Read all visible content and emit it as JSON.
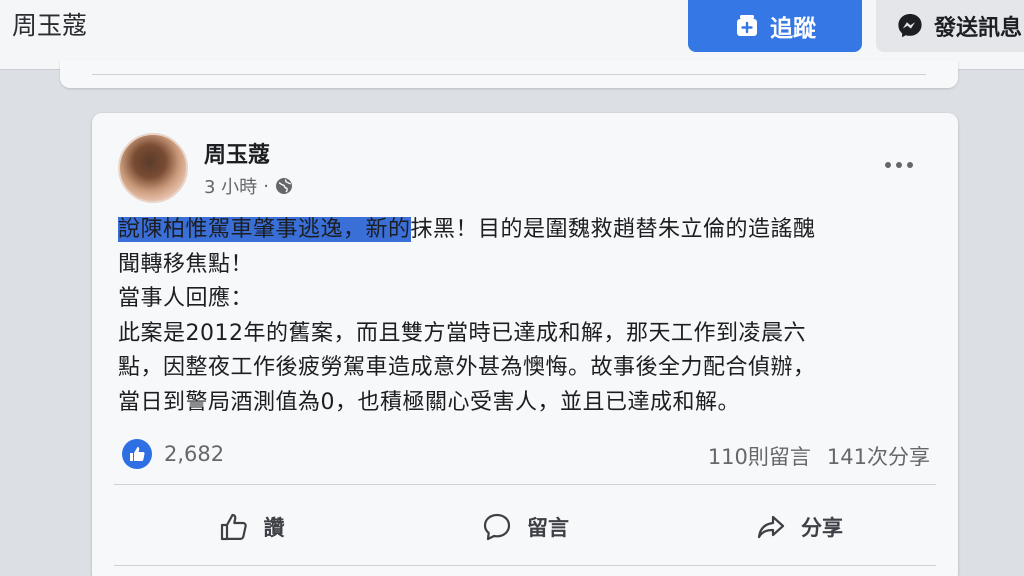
{
  "header": {
    "page_name": "周玉蔻",
    "follow_label": "追蹤",
    "message_label": "發送訊息"
  },
  "post": {
    "author": "周玉蔻",
    "time": "3 小時",
    "separator": "·",
    "highlighted_text": "說陳柏惟駕車肇事逃逸，新的",
    "line1_rest": "抹黑！目的是圍魏救趙替朱立倫的造謠醜",
    "line2": "聞轉移焦點！",
    "line3": "當事人回應：",
    "line4": "此案是2012年的舊案，而且雙方當時已達成和解，那天工作到凌晨六",
    "line5": "點，因整夜工作後疲勞駕車造成意外甚為懊悔。故事後全力配合偵辦，",
    "line6": "當日到警局酒測值為0，也積極關心受害人，並且已達成和解。"
  },
  "stats": {
    "likes": "2,682",
    "comments": "110則留言",
    "shares": "141次分享"
  },
  "actions": {
    "like": "讚",
    "comment": "留言",
    "share": "分享"
  },
  "colors": {
    "accent": "#3578e5",
    "highlight": "#3a6fd8"
  }
}
